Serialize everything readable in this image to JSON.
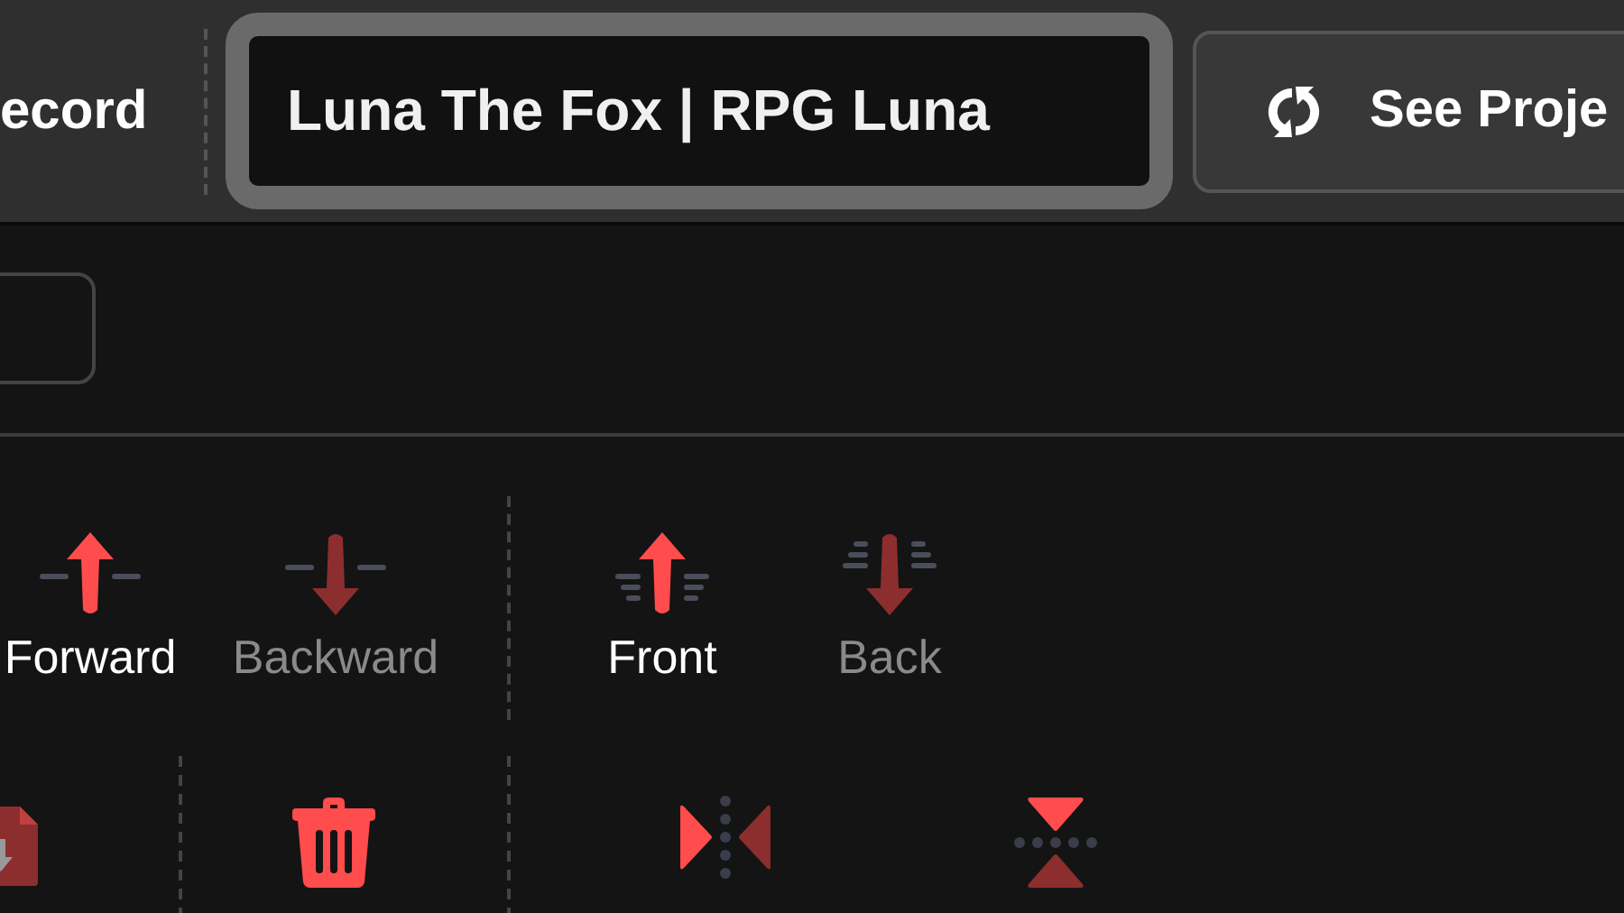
{
  "header": {
    "record_button": {
      "label": "ecord"
    },
    "title_field": {
      "value": "Luna The Fox | RPG Luna"
    },
    "see_project_button": {
      "label": "See Proje"
    }
  },
  "layer_buttons": [
    {
      "kind": "forward",
      "label": "Forward",
      "disabled": false
    },
    {
      "kind": "backward",
      "label": "Backward",
      "disabled": true
    },
    {
      "kind": "front",
      "label": "Front",
      "disabled": false
    },
    {
      "kind": "back",
      "label": "Back",
      "disabled": true
    }
  ]
}
